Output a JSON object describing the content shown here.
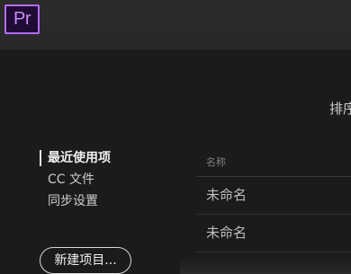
{
  "app": {
    "logo_text": "Pr"
  },
  "sort": {
    "label": "排序"
  },
  "nav": {
    "items": [
      {
        "label": "最近使用项",
        "active": true
      },
      {
        "label": "CC 文件",
        "active": false
      },
      {
        "label": "同步设置",
        "active": false
      }
    ]
  },
  "actions": {
    "new_project_label": "新建项目..."
  },
  "list": {
    "column_header": "名称",
    "rows": [
      {
        "name": "未命名"
      },
      {
        "name": "未命名"
      }
    ]
  },
  "colors": {
    "accent": "#b56bff",
    "background": "#1b1b1b",
    "topbar": "#2a2a2a"
  }
}
